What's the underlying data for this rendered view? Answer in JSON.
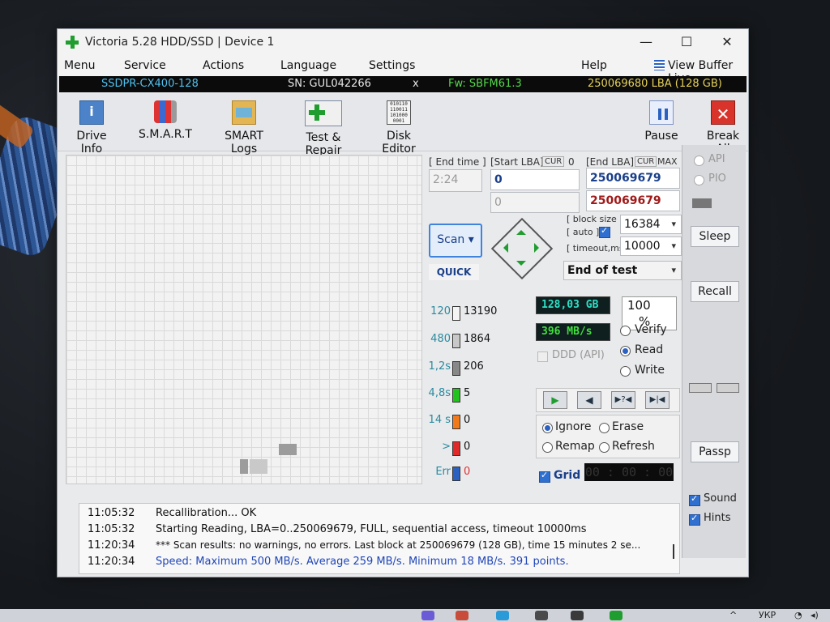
{
  "window": {
    "title": "Victoria 5.28 HDD/SSD | Device 1",
    "controls": {
      "minimize": "—",
      "maximize": "☐",
      "close": "✕"
    }
  },
  "menu": {
    "items": [
      "Menu",
      "Service",
      "Actions",
      "Language",
      "Settings",
      "Help"
    ],
    "view_buffer": "View Buffer Live"
  },
  "device_bar": {
    "model": "SSDPR-CX400-128",
    "serial": "SN: GUL042266",
    "close": "x",
    "firmware": "Fw: SBFM61.3",
    "lba": "250069680 LBA (128 GB)"
  },
  "toolbar": {
    "drive_info": "Drive Info",
    "smart": "S.M.A.R.T",
    "smart_logs": "SMART Logs",
    "test_repair": "Test & Repair",
    "disk_editor": "Disk Editor",
    "pause": "Pause",
    "break_all": "Break All",
    "disk_editor_glyph": "010110 110011 101000 0001"
  },
  "test": {
    "end_time_label": "[ End time ]",
    "end_time_value": "2:24",
    "start_lba_label": "[Start LBA]",
    "cur": "CUR",
    "zero": "0",
    "start_lba_value": "0",
    "start_lba_cur": "0",
    "end_lba_label": "[End LBA]",
    "end_lba_cur": "CUR",
    "end_lba_max": "MAX",
    "end_lba_value": "250069679",
    "end_lba_second": "250069679",
    "scan_label": "Scan",
    "quick_label": "QUICK",
    "block_size_label": "[ block size ]",
    "auto_label": "[ auto ]",
    "timeout_label": "[ timeout,ms ]",
    "block_size_value": "16384",
    "timeout_value": "10000",
    "end_action": "End of test"
  },
  "stats": [
    {
      "label": "120",
      "value": "13190",
      "color": "#f4f4f4"
    },
    {
      "label": "480",
      "value": "1864",
      "color": "#c8c8c8"
    },
    {
      "label": "1,2s",
      "value": "206",
      "color": "#888888"
    },
    {
      "label": "4,8s",
      "value": "5",
      "color": "#22c21f"
    },
    {
      "label": "14 s",
      "value": "0",
      "color": "#f07a1a"
    },
    {
      "label": ">",
      "value": "0",
      "color": "#e02a2a"
    },
    {
      "label": "Err",
      "value": "0",
      "color": "#2b62c2"
    }
  ],
  "status": {
    "size": "128,03 GB",
    "percent_value": "100",
    "percent_sign": "%",
    "speed": "396 MB/s",
    "ddd_label": "DDD (API)",
    "verify": "Verify",
    "read": "Read",
    "write": "Write",
    "ignore": "Ignore",
    "erase": "Erase",
    "remap": "Remap",
    "refresh": "Refresh",
    "grid": "Grid",
    "timer": "00 : 00 : 00",
    "play_icons": [
      "▶",
      "◀",
      "▶?◀",
      "▶|◀"
    ]
  },
  "side": {
    "api": "API",
    "pio": "PIO",
    "sleep": "Sleep",
    "recall": "Recall",
    "passp": "Passp",
    "sound": "Sound",
    "hints": "Hints"
  },
  "log": [
    {
      "time": "11:05:32",
      "msg": "Recallibration... OK",
      "blue": false
    },
    {
      "time": "11:05:32",
      "msg": "Starting Reading, LBA=0..250069679, FULL, sequential access, timeout 10000ms",
      "blue": false
    },
    {
      "time": "11:20:34",
      "msg": "*** Scan results: no warnings, no errors. Last block at 250069679 (128 GB), time 15 minutes 2 se...",
      "blue": false
    },
    {
      "time": "11:20:34",
      "msg": "Speed: Maximum 500 MB/s. Average 259 MB/s. Minimum 18 MB/s. 391 points.",
      "blue": true
    }
  ],
  "taskbar": {
    "lang": "УКР"
  }
}
